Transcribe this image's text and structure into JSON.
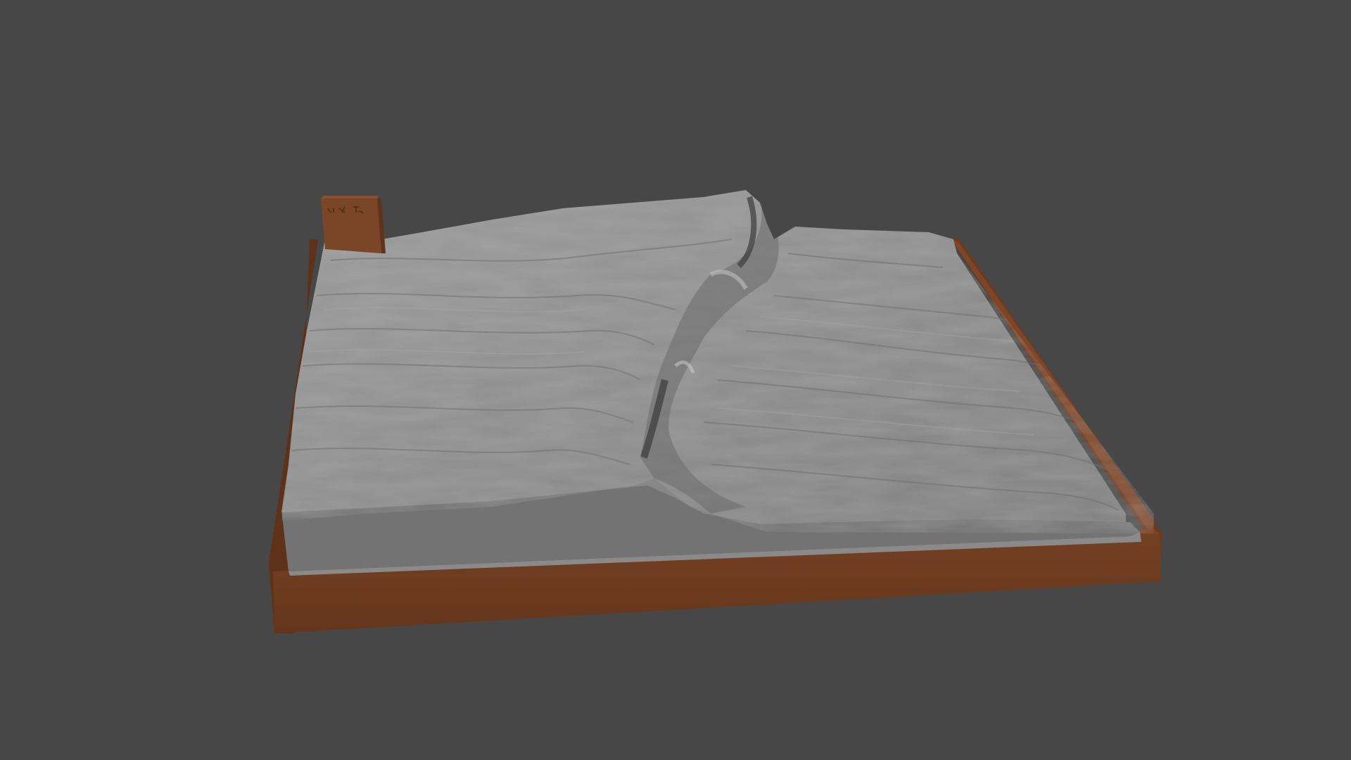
{
  "viewport": {
    "background_color": "#474747"
  },
  "terrain_model": {
    "base_color": "#6f3d22",
    "base_side_color": "#5e3219",
    "base_top_color": "#7a4426",
    "surface_color": "#8d8d8d",
    "surface_light_color": "#a3a3a3",
    "surface_shadow_color": "#5a5a5a",
    "flat_plateau_color": "#727272"
  },
  "label_block": {
    "color": "#7b4527",
    "engraved_text_visible": true
  }
}
